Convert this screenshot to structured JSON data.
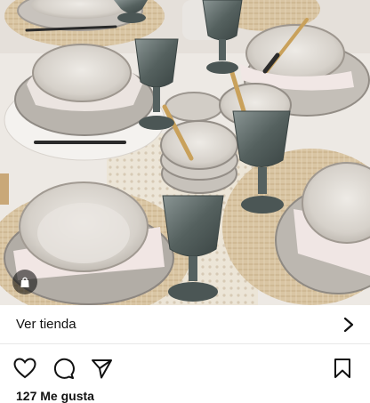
{
  "post": {
    "image_alt": "Mesa puesta con vajilla gris, copas de cristal verde y bajoplatos de fibra natural"
  },
  "shop": {
    "label": "Ver tienda",
    "chevron_icon": "chevron-right-icon",
    "bag_icon": "shopping-bag-icon"
  },
  "actions": {
    "like_icon": "heart-icon",
    "comment_icon": "comment-icon",
    "share_icon": "send-icon",
    "save_icon": "bookmark-icon"
  },
  "likes_text": "127 Me gusta",
  "colors": {
    "ceramic": "#d9d4ce",
    "glass": "#4f5b5a",
    "rattan": "#d8c3a0",
    "tablecloth": "#f0ede9"
  }
}
